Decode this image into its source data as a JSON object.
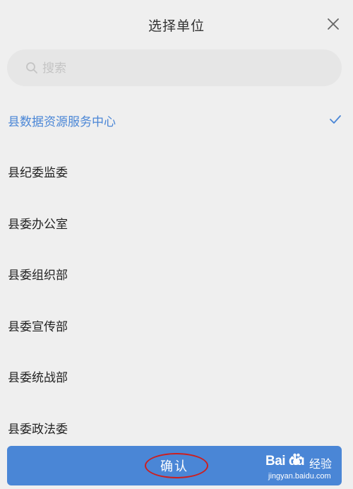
{
  "header": {
    "title": "选择单位",
    "close_icon": "close-icon"
  },
  "search": {
    "placeholder": "搜索",
    "value": "",
    "icon": "search-icon"
  },
  "units": [
    {
      "label": "县数据资源服务中心",
      "selected": true
    },
    {
      "label": "县纪委监委",
      "selected": false
    },
    {
      "label": "县委办公室",
      "selected": false
    },
    {
      "label": "县委组织部",
      "selected": false
    },
    {
      "label": "县委宣传部",
      "selected": false
    },
    {
      "label": "县委统战部",
      "selected": false
    },
    {
      "label": "县委政法委",
      "selected": false
    }
  ],
  "footer": {
    "confirm_label": "确认"
  },
  "watermark": {
    "brand": "Bai du",
    "cn": "经验",
    "url": "jingyan.baidu.com"
  },
  "colors": {
    "accent": "#4a86d6",
    "background": "#efefef",
    "search_bg": "#e6e6e6",
    "annotation": "#cc1f1f"
  }
}
